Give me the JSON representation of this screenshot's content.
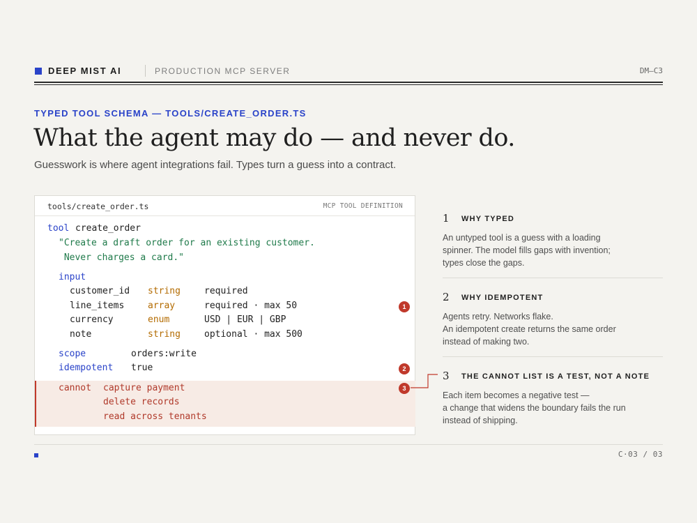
{
  "header": {
    "brand": "DEEP MIST AI",
    "section": "PRODUCTION MCP SERVER",
    "code": "DM—C3"
  },
  "eyebrow": "TYPED TOOL SCHEMA — TOOLS/CREATE_ORDER.TS",
  "title": "What the agent may do — and never do.",
  "subtitle": "Guesswork is where agent integrations fail. Types turn a guess into a contract.",
  "panel": {
    "filename": "tools/create_order.ts",
    "kind": "MCP TOOL DEFINITION",
    "tool_kw": "tool",
    "tool_name": "create_order",
    "description": [
      "\"Create a draft order for an existing customer.",
      " Never charges a card.\""
    ],
    "input_kw": "input",
    "fields": [
      {
        "name": "customer_id",
        "type": "string",
        "rule": "required"
      },
      {
        "name": "line_items",
        "type": "array",
        "rule": "required · max 50"
      },
      {
        "name": "currency",
        "type": "enum",
        "rule": "USD | EUR | GBP"
      },
      {
        "name": "note",
        "type": "string",
        "rule": "optional · max 500"
      }
    ],
    "scope_kw": "scope",
    "scope_val": "orders:write",
    "idem_kw": "idempotent",
    "idem_val": "true",
    "cannot_kw": "cannot",
    "cannot_items": [
      "capture payment",
      "delete records",
      "read across tenants"
    ],
    "badges": [
      "1",
      "2",
      "3"
    ]
  },
  "notes": [
    {
      "num": "1",
      "title": "WHY TYPED",
      "lines": [
        "An untyped tool is a guess with a loading",
        "spinner. The model fills gaps with invention;",
        "types close the gaps."
      ]
    },
    {
      "num": "2",
      "title": "WHY IDEMPOTENT",
      "lines": [
        "Agents retry. Networks flake.",
        "An idempotent create returns the same order",
        "instead of making two."
      ]
    },
    {
      "num": "3",
      "title": "THE CANNOT LIST IS A TEST, NOT A NOTE",
      "lines": [
        "Each item becomes a negative test —",
        "a change that widens the boundary fails the run",
        "instead of shipping."
      ]
    }
  ],
  "footer": {
    "page": "C·03 / 03"
  },
  "colors": {
    "accent": "#2a43c9",
    "alert": "#c0392b",
    "string": "#1f7a4a",
    "type": "#b36b00",
    "background": "#f4f3ef"
  }
}
